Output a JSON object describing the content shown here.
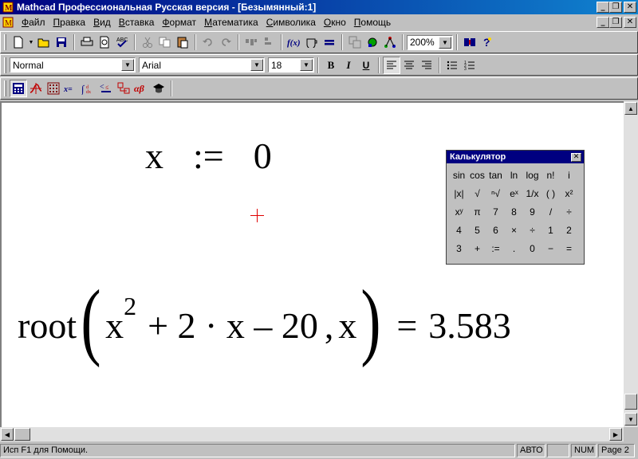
{
  "window": {
    "title": "Mathcad Профессиональная Русская версия - [Безымянный:1]"
  },
  "menu": {
    "items": [
      "Файл",
      "Правка",
      "Вид",
      "Вставка",
      "Формат",
      "Математика",
      "Символика",
      "Окно",
      "Помощь"
    ]
  },
  "toolbar_standard": {
    "zoom": "200%"
  },
  "toolbar_format": {
    "style": "Normal",
    "font": "Arial",
    "size": "18",
    "bold": "B",
    "italic": "I",
    "underline": "U"
  },
  "toolbar_math": {
    "items": [
      "calculator-toolbar",
      "graph-toolbar",
      "matrix-toolbar",
      "evaluation-toolbar",
      "calculus-toolbar",
      "boolean-toolbar",
      "programming-toolbar",
      "greek-toolbar",
      "symbolic-toolbar"
    ]
  },
  "document": {
    "expr1": {
      "variable": "x",
      "operator": ":=",
      "value": "0"
    },
    "expr2": {
      "function": "root",
      "base": "x",
      "exponent": "2",
      "rest": "+ 2 · x – 20",
      "comma": ",",
      "arg": "x",
      "equals": "=",
      "result": "3.583"
    }
  },
  "calculator": {
    "title": "Калькулятор",
    "keys": [
      "sin",
      "cos",
      "tan",
      "ln",
      "log",
      "n!",
      "i",
      "|x|",
      "√",
      "ⁿ√",
      "eˣ",
      "1/x",
      "( )",
      "x²",
      "xʸ",
      "π",
      "7",
      "8",
      "9",
      "/",
      "÷",
      "4",
      "5",
      "6",
      "×",
      "÷",
      "1",
      "2",
      "3",
      "+",
      ":=",
      ".",
      "0",
      "−",
      "="
    ]
  },
  "status": {
    "help": "Исп F1 для Помощи.",
    "mode": "АВТО",
    "num": "NUM",
    "page": "Page 2"
  }
}
